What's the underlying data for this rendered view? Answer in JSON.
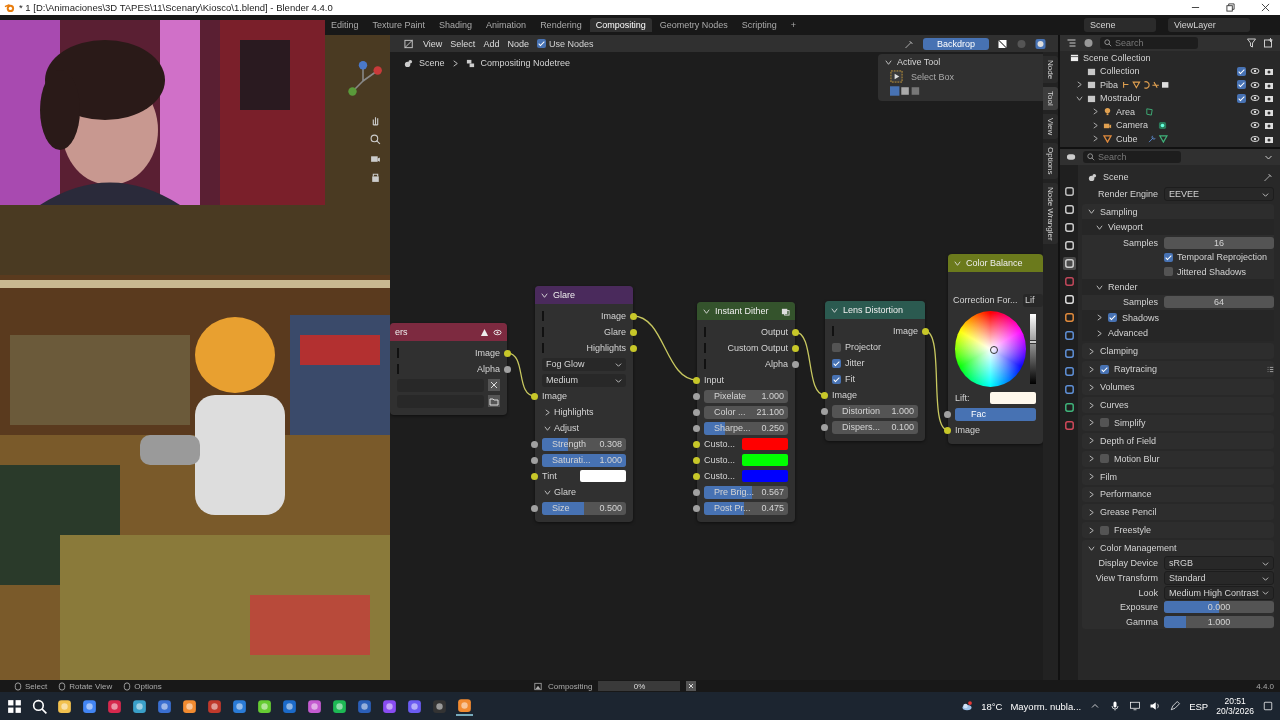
{
  "title_bar": {
    "title": "* 1 [D:\\Animaciones\\3D TAPES\\11\\Scenary\\Kiosco\\1.blend] - Blender 4.4.0"
  },
  "workspaces": [
    {
      "label": "Editing",
      "selected": false
    },
    {
      "label": "Texture Paint",
      "selected": false
    },
    {
      "label": "Shading",
      "selected": false
    },
    {
      "label": "Animation",
      "selected": false
    },
    {
      "label": "Rendering",
      "selected": false
    },
    {
      "label": "Compositing",
      "selected": true
    },
    {
      "label": "Geometry Nodes",
      "selected": false
    },
    {
      "label": "Scripting",
      "selected": false
    }
  ],
  "add_workspace": "+",
  "scene_selector": {
    "scene": "Scene",
    "view_layer": "ViewLayer"
  },
  "node_header": {
    "menus": [
      "View",
      "Select",
      "Add",
      "Node"
    ],
    "use_nodes": {
      "label": "Use Nodes",
      "checked": true
    },
    "backdrop": {
      "label": "Backdrop",
      "on": true
    }
  },
  "breadcrumb": [
    "Scene",
    "Compositing Nodetree"
  ],
  "active_tool": {
    "title": "Active Tool",
    "tool": "Select Box",
    "expanded": true
  },
  "sidebar_tabs": [
    {
      "label": "Node",
      "selected": false
    },
    {
      "label": "Tool",
      "selected": true
    },
    {
      "label": "View",
      "selected": false
    },
    {
      "label": "Options",
      "selected": false
    },
    {
      "label": "Node Wrangler",
      "selected": false
    }
  ],
  "nodes": [
    {
      "title": "ers",
      "kind": "layers",
      "color": "#7d2a40",
      "rows": [
        {
          "kind": "output",
          "label": "Image",
          "socket": {
            "color": "#c7c729"
          }
        },
        {
          "kind": "output",
          "label": "Alpha",
          "socket": {
            "color": "#a1a1a1"
          }
        },
        {
          "kind": "file-field"
        },
        {
          "kind": "file-select"
        }
      ]
    },
    {
      "title": "Glare",
      "kind": "plain",
      "color": "#4a2a5c",
      "rows": [
        {
          "kind": "output",
          "label": "Image",
          "socket": {
            "color": "#c7c729"
          }
        },
        {
          "kind": "output",
          "label": "Glare",
          "socket": {
            "color": "#c7c729"
          }
        },
        {
          "kind": "output",
          "label": "Highlights",
          "socket": {
            "color": "#c7c729"
          }
        },
        {
          "kind": "dropdown",
          "label": "Fog Glow"
        },
        {
          "kind": "dropdown",
          "label": "Medium"
        },
        {
          "kind": "input",
          "label": "Image",
          "socket": {
            "color": "#c7c729"
          }
        },
        {
          "kind": "panel",
          "label": "Highlights",
          "expanded": false
        },
        {
          "kind": "panel",
          "label": "Adjust",
          "expanded": true
        },
        {
          "kind": "slider",
          "label": "Strength",
          "value": "0.308",
          "level": 0.308,
          "socket": {
            "color": "#a1a1a1"
          }
        },
        {
          "kind": "slider",
          "label": "Saturati...",
          "value": "1.000",
          "level": 1,
          "socket": {
            "color": "#a1a1a1"
          }
        },
        {
          "kind": "color",
          "label": "Tint",
          "color": "#ffffff",
          "socket": {
            "color": "#c7c729"
          }
        },
        {
          "kind": "panel",
          "label": "Glare",
          "expanded": true
        },
        {
          "kind": "slider",
          "label": "Size",
          "value": "0.500",
          "level": 0.5,
          "socket": {
            "color": "#a1a1a1"
          }
        }
      ]
    },
    {
      "title": "Instant Dither",
      "kind": "group",
      "color": "#34532c",
      "rows": [
        {
          "kind": "output",
          "label": "Output",
          "socket": {
            "color": "#c7c729"
          }
        },
        {
          "kind": "output",
          "label": "Custom Output",
          "socket": {
            "color": "#c7c729"
          }
        },
        {
          "kind": "output",
          "label": "Alpha",
          "socket": {
            "color": "#a1a1a1"
          }
        },
        {
          "kind": "input",
          "label": "Input",
          "socket": {
            "color": "#c7c729"
          }
        },
        {
          "kind": "number",
          "label": "Pixelate",
          "value": "1.000",
          "socket": {
            "color": "#a1a1a1"
          }
        },
        {
          "kind": "number",
          "label": "Color ...",
          "value": "21.100",
          "socket": {
            "color": "#a1a1a1"
          }
        },
        {
          "kind": "slider",
          "label": "Sharpe...",
          "value": "0.250",
          "level": 0.25,
          "socket": {
            "color": "#a1a1a1"
          }
        },
        {
          "kind": "color",
          "label": "Custo...",
          "color": "#ff0000",
          "socket": {
            "color": "#c7c729"
          }
        },
        {
          "kind": "color",
          "label": "Custo...",
          "color": "#00ff00",
          "socket": {
            "color": "#c7c729"
          }
        },
        {
          "kind": "color",
          "label": "Custo...",
          "color": "#0000ff",
          "socket": {
            "color": "#c7c729"
          }
        },
        {
          "kind": "slider",
          "label": "Pre Brig...",
          "value": "0.567",
          "level": 0.567,
          "socket": {
            "color": "#a1a1a1"
          }
        },
        {
          "kind": "slider",
          "label": "Post Pr...",
          "value": "0.475",
          "level": 0.475,
          "socket": {
            "color": "#a1a1a1"
          }
        }
      ]
    },
    {
      "title": "Lens Distortion",
      "kind": "plain",
      "color": "#2b5a50",
      "rows": [
        {
          "kind": "output",
          "label": "Image",
          "socket": {
            "color": "#c7c729"
          }
        },
        {
          "kind": "check",
          "label": "Projector",
          "checked": false
        },
        {
          "kind": "check",
          "label": "Jitter",
          "checked": true
        },
        {
          "kind": "check",
          "label": "Fit",
          "checked": true
        },
        {
          "kind": "input",
          "label": "Image",
          "socket": {
            "color": "#c7c729"
          }
        },
        {
          "kind": "number",
          "label": "Distortion",
          "value": "1.000",
          "socket": {
            "color": "#a1a1a1"
          }
        },
        {
          "kind": "number",
          "label": "Dispers...",
          "value": "0.100",
          "socket": {
            "color": "#a1a1a1"
          }
        }
      ]
    },
    {
      "title": "Color Balance",
      "kind": "plain",
      "color": "#6b7a1c",
      "rows": [
        {
          "kind": "spacer"
        },
        {
          "kind": "choice",
          "label": "Correction For...",
          "value": "Lif"
        },
        {
          "kind": "wheel",
          "level": 0.6
        },
        {
          "kind": "color",
          "label": "Lift:",
          "color": "#fff8ec"
        },
        {
          "kind": "fac",
          "label": "Fac",
          "level": 1,
          "socket": {
            "color": "#a1a1a1"
          }
        },
        {
          "kind": "input",
          "label": "Image",
          "socket": {
            "color": "#c7c729"
          }
        }
      ]
    }
  ],
  "outliner": {
    "search_placeholder": "Search",
    "tree": [
      {
        "label": "Scene Collection",
        "kind": "scene-collection",
        "children": [
          {
            "label": "Collection",
            "kind": "collection",
            "checked": true
          },
          {
            "label": "Piba",
            "kind": "collection",
            "expanded": false,
            "checked": true,
            "has_armature": true
          },
          {
            "label": "Mostrador",
            "kind": "collection",
            "expanded": true,
            "checked": true,
            "children": [
              {
                "label": "Area",
                "kind": "light",
                "expanded": false
              },
              {
                "label": "Camera",
                "kind": "camera",
                "expanded": false
              },
              {
                "label": "Cube",
                "kind": "mesh",
                "expanded": false
              }
            ]
          }
        ]
      }
    ]
  },
  "properties": {
    "search_placeholder": "Search",
    "context": "Scene",
    "tabs": [
      {
        "kind": "tool",
        "selected": false
      },
      {
        "kind": "render",
        "selected": false
      },
      {
        "kind": "output",
        "selected": false
      },
      {
        "kind": "view-layer",
        "selected": false
      },
      {
        "kind": "scene",
        "selected": true
      },
      {
        "kind": "world",
        "selected": false
      },
      {
        "kind": "collection",
        "selected": false
      },
      {
        "kind": "object",
        "selected": false
      },
      {
        "kind": "modifier",
        "selected": false
      },
      {
        "kind": "particles",
        "selected": false
      },
      {
        "kind": "physics",
        "selected": false
      },
      {
        "kind": "constraints",
        "selected": false
      },
      {
        "kind": "data",
        "selected": false
      },
      {
        "kind": "material",
        "selected": false
      }
    ],
    "render_engine": {
      "label": "Render Engine",
      "value": "EEVEE"
    },
    "panels": [
      {
        "label": "Sampling",
        "expanded": true,
        "children": [
          {
            "kind": "subpanel",
            "label": "Viewport",
            "expanded": true,
            "children": [
              {
                "kind": "number",
                "label": "Samples",
                "value": "16"
              },
              {
                "kind": "check",
                "label": "Temporal Reprojection",
                "checked": true
              },
              {
                "kind": "check",
                "label": "Jittered Shadows",
                "checked": false
              }
            ]
          },
          {
            "kind": "subpanel",
            "label": "Render",
            "expanded": true,
            "children": [
              {
                "kind": "number",
                "label": "Samples",
                "value": "64"
              }
            ]
          },
          {
            "kind": "subpanel",
            "label": "Shadows",
            "expanded": false,
            "checked": true
          },
          {
            "kind": "subpanel",
            "label": "Advanced",
            "expanded": false
          }
        ]
      },
      {
        "label": "Clamping",
        "expanded": false
      },
      {
        "label": "Raytracing",
        "expanded": false,
        "checked": true,
        "list_icon": true
      },
      {
        "label": "Volumes",
        "expanded": false
      },
      {
        "label": "Curves",
        "expanded": false
      },
      {
        "label": "Simplify",
        "expanded": false,
        "checked": false
      },
      {
        "label": "Depth of Field",
        "expanded": false
      },
      {
        "label": "Motion Blur",
        "expanded": false,
        "checked": false
      },
      {
        "label": "Film",
        "expanded": false
      },
      {
        "label": "Performance",
        "expanded": false
      },
      {
        "label": "Grease Pencil",
        "expanded": false
      },
      {
        "label": "Freestyle",
        "expanded": false,
        "checked": false
      },
      {
        "label": "Color Management",
        "expanded": true,
        "children": [
          {
            "kind": "dropdown",
            "label": "Display Device",
            "value": "sRGB"
          },
          {
            "kind": "dropdown",
            "label": "View Transform",
            "value": "Standard"
          },
          {
            "kind": "dropdown",
            "label": "Look",
            "value": "Medium High Contrast"
          },
          {
            "kind": "slider",
            "label": "Exposure",
            "value": "0.000",
            "level": 0.5
          },
          {
            "kind": "slider",
            "label": "Gamma",
            "value": "1.000",
            "level": 0.2
          }
        ]
      }
    ]
  },
  "status_bar": {
    "hints": [
      "Select",
      "Rotate View",
      "Options"
    ],
    "job": "Compositing",
    "progress": {
      "level": 0,
      "reading": "0%"
    },
    "version": "4.4.0"
  },
  "taskbar": {
    "weather": {
      "temp": "18°C",
      "text": "Mayorm. nubla..."
    },
    "language": "ESP",
    "time": "20:51",
    "date": "20/3/2026"
  }
}
